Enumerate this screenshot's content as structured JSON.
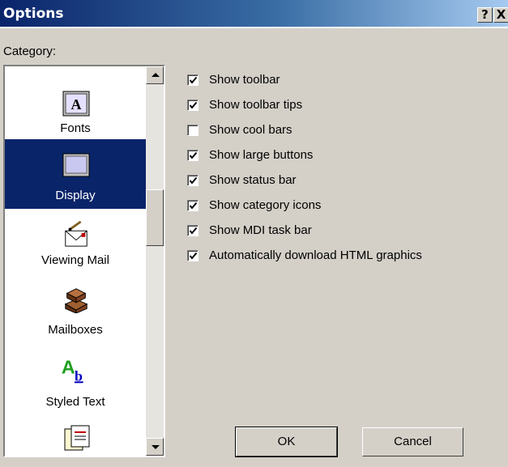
{
  "window": {
    "title": "Options",
    "help_label": "?",
    "close_label": "X"
  },
  "category_label": "Category:",
  "categories": [
    {
      "label": "Fonts",
      "icon": "fonts-icon",
      "selected": false
    },
    {
      "label": "Display",
      "icon": "display-icon",
      "selected": true
    },
    {
      "label": "Viewing Mail",
      "icon": "viewing-mail-icon",
      "selected": false
    },
    {
      "label": "Mailboxes",
      "icon": "mailboxes-icon",
      "selected": false
    },
    {
      "label": "Styled Text",
      "icon": "styled-text-icon",
      "selected": false
    }
  ],
  "options": [
    {
      "label": "Show toolbar",
      "checked": true
    },
    {
      "label": "Show toolbar tips",
      "checked": true
    },
    {
      "label": "Show cool bars",
      "checked": false
    },
    {
      "label": "Show large buttons",
      "checked": true
    },
    {
      "label": "Show status bar",
      "checked": true
    },
    {
      "label": "Show category icons",
      "checked": true
    },
    {
      "label": "Show MDI task bar",
      "checked": true
    },
    {
      "label": "Automatically download HTML graphics",
      "checked": true
    }
  ],
  "buttons": {
    "ok": "OK",
    "cancel": "Cancel"
  },
  "colors": {
    "selection": "#0a246a",
    "face": "#d4d0c8",
    "title_start": "#0a246a",
    "title_end": "#a6caf0"
  }
}
